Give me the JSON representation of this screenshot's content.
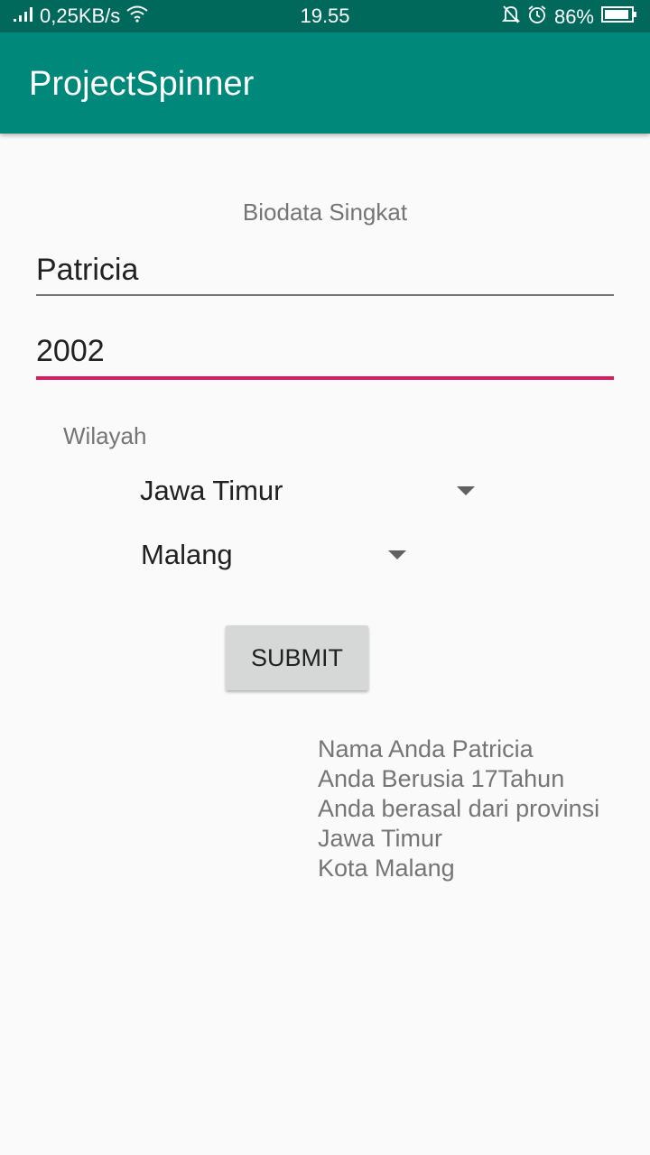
{
  "status_bar": {
    "signal_icon": "signal-icon",
    "speed": "0,25KB/s",
    "wifi_icon": "wifi-icon",
    "time": "19.55",
    "mute_icon": "notifications-off-icon",
    "alarm_icon": "alarm-icon",
    "battery": "86%",
    "battery_icon": "battery-icon"
  },
  "app_bar": {
    "title": "ProjectSpinner",
    "color": "#00897b"
  },
  "form": {
    "heading": "Biodata Singkat",
    "name_value": "Patricia",
    "year_value": "2002",
    "accent_color": "#d81b60",
    "region_label": "Wilayah",
    "province_selected": "Jawa Timur",
    "city_selected": "Malang",
    "submit_label": "SUBMIT"
  },
  "result": {
    "lines": [
      "Nama Anda Patricia",
      "Anda Berusia 17Tahun",
      "Anda berasal dari provinsi",
      "Jawa Timur",
      "Kota Malang"
    ]
  }
}
